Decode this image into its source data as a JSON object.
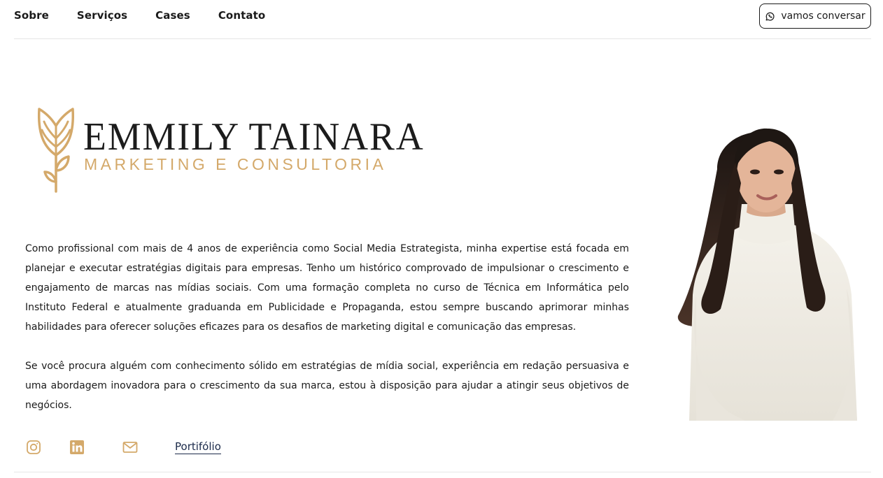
{
  "nav": {
    "links": [
      "Sobre",
      "Serviços",
      "Cases",
      "Contato"
    ],
    "cta_label": "vamos conversar",
    "cta_icon": "whatsapp-icon"
  },
  "logo": {
    "name": "EMMILY TAINARA",
    "subtitle": "MARKETING E CONSULTORIA",
    "accent_color": "#d4a96a"
  },
  "bio": {
    "paragraphs": [
      "Como profissional com mais de 4 anos de experiência como Social Media Estrategista, minha expertise está focada em planejar e executar estratégias digitais para empresas. Tenho um histórico comprovado de impulsionar o crescimento e engajamento de marcas nas mídias sociais. Com uma formação completa no curso de Técnica em Informática pelo Instituto Federal e atualmente graduanda em Publicidade e Propaganda, estou sempre buscando aprimorar minhas habilidades para oferecer soluções eficazes para os desafios de marketing digital e comunicação das empresas.",
      "Se você procura alguém com conhecimento sólido em estratégias de mídia social, experiência em redação persuasiva e uma abordagem inovadora para o crescimento da sua marca, estou à disposição para ajudar a atingir seus objetivos de negócios."
    ]
  },
  "social": {
    "icons": [
      "instagram-icon",
      "linkedin-icon",
      "mail-icon"
    ],
    "portfolio_label": "Portifólio",
    "icon_color": "#d4a96a",
    "link_color": "#1b2a4a"
  }
}
